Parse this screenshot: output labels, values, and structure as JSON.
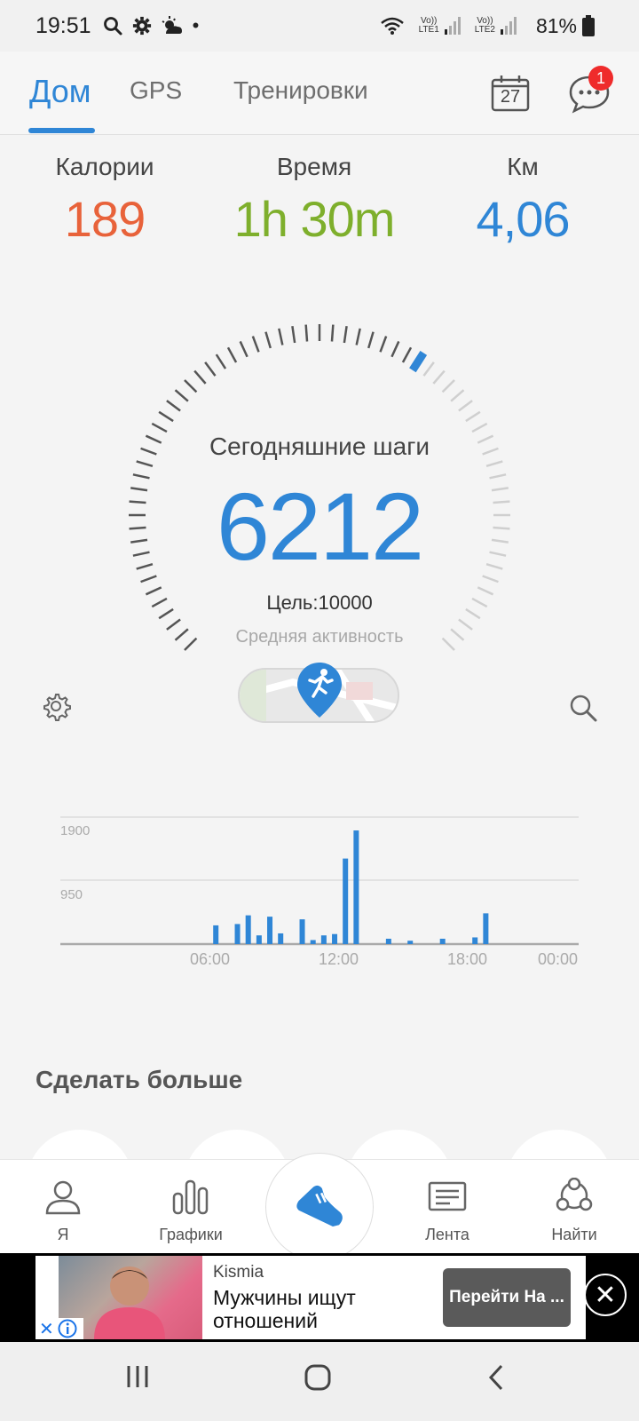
{
  "status_bar": {
    "time": "19:51",
    "dot": "•",
    "sim1": "LTE1",
    "sim2": "LTE2",
    "volte": "Vo))",
    "battery": "81%"
  },
  "top_tabs": {
    "items": [
      {
        "label": "Дом"
      },
      {
        "label": "GPS"
      },
      {
        "label": "Тренировки"
      }
    ],
    "calendar_day": "27",
    "message_badge": "1"
  },
  "stats": {
    "calories": {
      "label": "Калории",
      "value": "189",
      "color": "#e8623a"
    },
    "time": {
      "label": "Время",
      "value": "1h 30m",
      "color": "#7eaf2c"
    },
    "distance": {
      "label": "Км",
      "value": "4,06",
      "color": "#2f86d6"
    }
  },
  "steps": {
    "title": "Сегодняшние шаги",
    "value": "6212",
    "goal": "Цель:10000",
    "activity": "Средняя активность",
    "progress": 0.6212
  },
  "chart_data": {
    "type": "bar",
    "y_ticks": [
      "1900",
      "950"
    ],
    "x_ticks": [
      "06:00",
      "12:00",
      "18:00",
      "00:00"
    ],
    "ylim": [
      0,
      1900
    ],
    "x_range_hours": [
      0,
      24
    ],
    "color": "#2f86d6",
    "bars": [
      {
        "hour": 7.2,
        "value": 280
      },
      {
        "hour": 8.2,
        "value": 300
      },
      {
        "hour": 8.7,
        "value": 430
      },
      {
        "hour": 9.2,
        "value": 130
      },
      {
        "hour": 9.7,
        "value": 410
      },
      {
        "hour": 10.2,
        "value": 160
      },
      {
        "hour": 11.2,
        "value": 370
      },
      {
        "hour": 11.7,
        "value": 60
      },
      {
        "hour": 12.2,
        "value": 130
      },
      {
        "hour": 12.7,
        "value": 150
      },
      {
        "hour": 13.2,
        "value": 1280
      },
      {
        "hour": 13.7,
        "value": 1700
      },
      {
        "hour": 15.2,
        "value": 80
      },
      {
        "hour": 16.2,
        "value": 50
      },
      {
        "hour": 17.7,
        "value": 80
      },
      {
        "hour": 19.2,
        "value": 100
      },
      {
        "hour": 19.7,
        "value": 460
      }
    ]
  },
  "do_more": {
    "title": "Сделать больше"
  },
  "bottom_nav": {
    "items": [
      {
        "label": "Я"
      },
      {
        "label": "Графики"
      },
      {
        "label": "Лента"
      },
      {
        "label": "Найти"
      }
    ]
  },
  "ad": {
    "brand": "Kismia",
    "text": "Мужчины ищут отношений",
    "cta": "Перейти На ...",
    "close": "✕"
  }
}
